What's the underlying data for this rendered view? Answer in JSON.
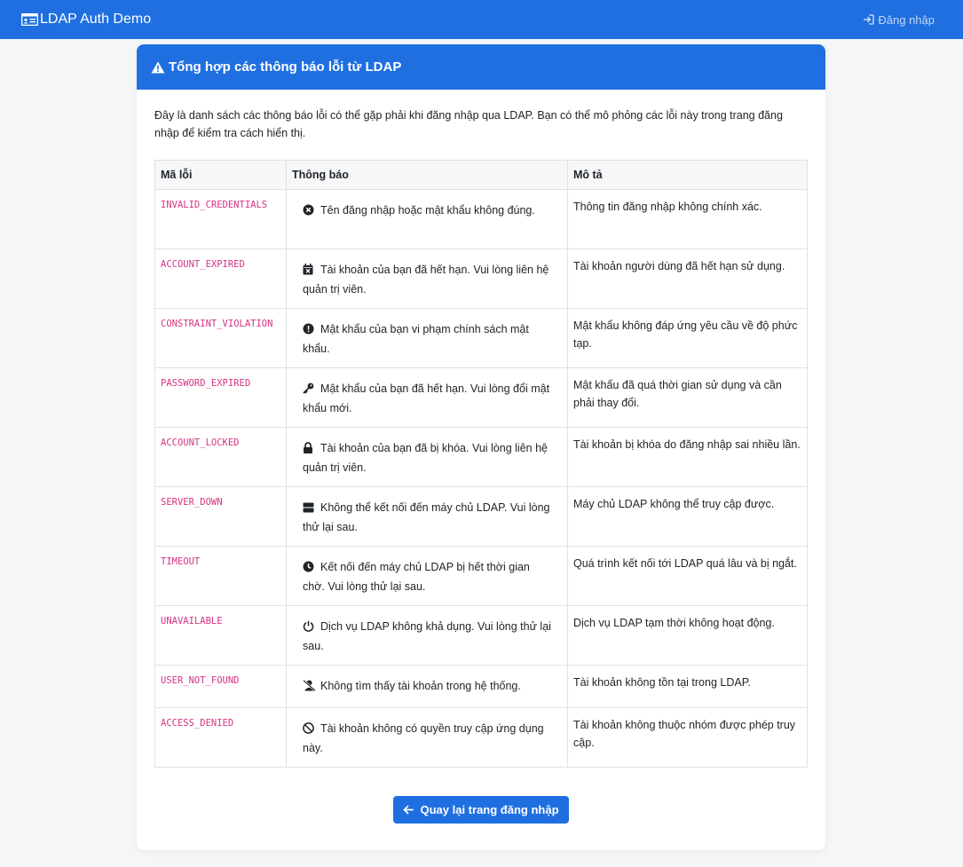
{
  "navbar": {
    "brand": "LDAP Auth Demo",
    "login_link": "Đăng nhập"
  },
  "card": {
    "title": "Tổng hợp các thông báo lỗi từ LDAP",
    "intro": "Đây là danh sách các thông báo lỗi có thể gặp phải khi đăng nhập qua LDAP. Bạn có thể mô phỏng các lỗi này trong trang đăng nhập để kiểm tra cách hiển thị."
  },
  "table": {
    "headers": [
      "Mã lỗi",
      "Thông báo",
      "Mô tả"
    ],
    "rows": [
      {
        "code": "INVALID_CREDENTIALS",
        "icon": "x-circle-icon",
        "message": "Tên đăng nhập hoặc mật khẩu không đúng.",
        "description": "Thông tin đăng nhập không chính xác."
      },
      {
        "code": "ACCOUNT_EXPIRED",
        "icon": "calendar-x-icon",
        "message": "Tài khoản của bạn đã hết hạn. Vui lòng liên hệ quản trị viên.",
        "description": "Tài khoản người dùng đã hết hạn sử dụng."
      },
      {
        "code": "CONSTRAINT_VIOLATION",
        "icon": "exclamation-circle-icon",
        "message": "Mật khẩu của bạn vi phạm chính sách mật khẩu.",
        "description": "Mật khẩu không đáp ứng yêu cầu về độ phức tạp."
      },
      {
        "code": "PASSWORD_EXPIRED",
        "icon": "key-icon",
        "message": "Mật khẩu của bạn đã hết hạn. Vui lòng đổi mật khẩu mới.",
        "description": "Mật khẩu đã quá thời gian sử dụng và cần phải thay đổi."
      },
      {
        "code": "ACCOUNT_LOCKED",
        "icon": "lock-icon",
        "message": "Tài khoản của bạn đã bị khóa. Vui lòng liên hệ quản trị viên.",
        "description": "Tài khoản bị khóa do đăng nhập sai nhiều lần."
      },
      {
        "code": "SERVER_DOWN",
        "icon": "server-icon",
        "message": "Không thể kết nối đến máy chủ LDAP. Vui lòng thử lại sau.",
        "description": "Máy chủ LDAP không thể truy cập được."
      },
      {
        "code": "TIMEOUT",
        "icon": "clock-icon",
        "message": "Kết nối đến máy chủ LDAP bị hết thời gian chờ. Vui lòng thử lại sau.",
        "description": "Quá trình kết nối tới LDAP quá lâu và bị ngắt."
      },
      {
        "code": "UNAVAILABLE",
        "icon": "power-icon",
        "message": "Dịch vụ LDAP không khả dụng. Vui lòng thử lại sau.",
        "description": "Dịch vụ LDAP tạm thời không hoạt động."
      },
      {
        "code": "USER_NOT_FOUND",
        "icon": "user-slash-icon",
        "message": "Không tìm thấy tài khoản trong hệ thống.",
        "description": "Tài khoản không tồn tại trong LDAP."
      },
      {
        "code": "ACCESS_DENIED",
        "icon": "ban-icon",
        "message": "Tài khoản không có quyền truy cập ứng dụng này.",
        "description": "Tài khoản không thuộc nhóm được phép truy cập."
      }
    ]
  },
  "back_button": "Quay lại trang đăng nhập",
  "colors": {
    "primary": "#1f6fe0",
    "code": "#d63384",
    "background": "#f5f6f8"
  }
}
